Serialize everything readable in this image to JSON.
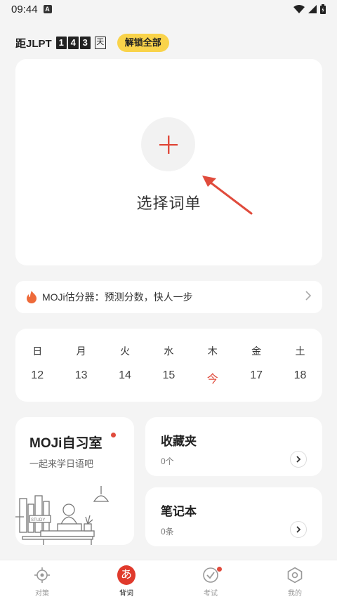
{
  "status_bar": {
    "time": "09:44",
    "notification_icon": "A"
  },
  "countdown": {
    "prefix": "距JLPT",
    "digits": [
      "1",
      "4",
      "3"
    ],
    "suffix": "天",
    "unlock_label": "解锁全部"
  },
  "main_card": {
    "choose_label": "选择词单",
    "plus_icon": "plus-icon"
  },
  "estimator": {
    "text": "MOJi估分器：预测分数，快人一步",
    "icon": "fire-icon"
  },
  "calendar": {
    "weekdays": [
      "日",
      "月",
      "火",
      "水",
      "木",
      "金",
      "土"
    ],
    "days": [
      "12",
      "13",
      "14",
      "15",
      "今",
      "17",
      "18"
    ],
    "today_index": 4
  },
  "study_room": {
    "title": "MOJi自习室",
    "subtitle": "一起来学日语吧"
  },
  "favorites": {
    "title": "收藏夹",
    "count": "0个"
  },
  "notebook": {
    "title": "笔记本",
    "count": "0条"
  },
  "bottom_nav": [
    {
      "label": "对策",
      "icon": "target-icon"
    },
    {
      "label": "背词",
      "icon": "kana-icon",
      "glyph": "あ"
    },
    {
      "label": "考试",
      "icon": "check-circle-icon"
    },
    {
      "label": "我的",
      "icon": "hexagon-icon"
    }
  ],
  "colors": {
    "accent": "#e04b3c",
    "unlock": "#f9d34a",
    "background": "#f4f4f4"
  }
}
